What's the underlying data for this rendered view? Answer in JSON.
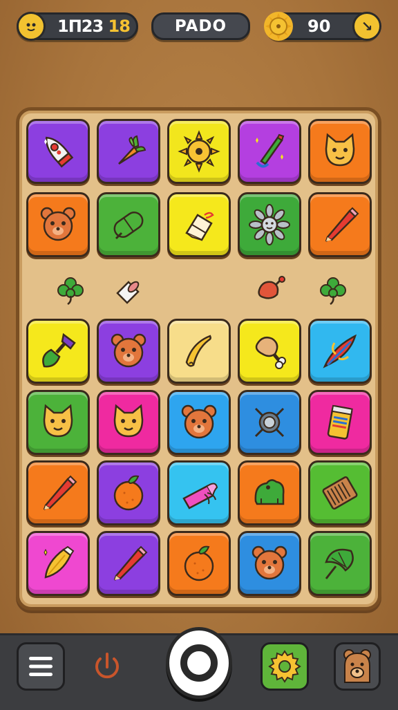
{
  "hud": {
    "score_main": "1Π23",
    "score_accent": "18",
    "title": "PADO",
    "coins": "90"
  },
  "board": {
    "rows": [
      [
        "rocket",
        "carrot",
        "sun-gear",
        "paintbrush-sparkle",
        "cat-face"
      ],
      [
        "bear-face",
        "green-capsule",
        "cloth-bundle",
        "gray-flower",
        "pencil"
      ],
      [
        "bottle-brush",
        "bear-face",
        "banana",
        "chicken-leg",
        "feather-quill"
      ],
      [
        "cat-face",
        "cat-face",
        "bear-face",
        "target-dish",
        "cup-can"
      ],
      [
        "pencil",
        "orange-fruit",
        "gift-roll",
        "frog",
        "chocolate-bar"
      ],
      [
        "pen-nib",
        "pencil",
        "orange-fruit",
        "bear-face",
        "leaf-umbrella"
      ]
    ],
    "tile_colors": [
      [
        "#8c3fe0",
        "#8c3fe0",
        "#f2e61d",
        "#b43fe0",
        "#f57a1c"
      ],
      [
        "#f57a1c",
        "#4cb23a",
        "#f5e81c",
        "#3eaa3a",
        "#f57a1c"
      ],
      [
        "#f5e81c",
        "#8c3fe0",
        "#f7dd8a",
        "#f5e81c",
        "#31b8ef"
      ],
      [
        "#4cb23a",
        "#ef2aa0",
        "#2ea5ef",
        "#2e8ee0",
        "#ef2aa0"
      ],
      [
        "#f57a1c",
        "#8c3fe0",
        "#35c3f0",
        "#f57a1c",
        "#55bd33"
      ],
      [
        "#ef48d0",
        "#8c3fe0",
        "#f57a1c",
        "#2e8ee0",
        "#4cb23a"
      ]
    ],
    "loose_items": [
      "clover",
      "paper-roll",
      "meat-drumstick",
      "clover"
    ]
  },
  "bottom_bar": {
    "buttons": [
      "menu-icon",
      "power-icon",
      "play-ring-icon",
      "gear-icon",
      "bear-icon"
    ]
  },
  "colors": {
    "background": "#a8743c",
    "board": "#e3c089",
    "bar": "#3c3d40",
    "accent_yellow": "#f5c232"
  }
}
